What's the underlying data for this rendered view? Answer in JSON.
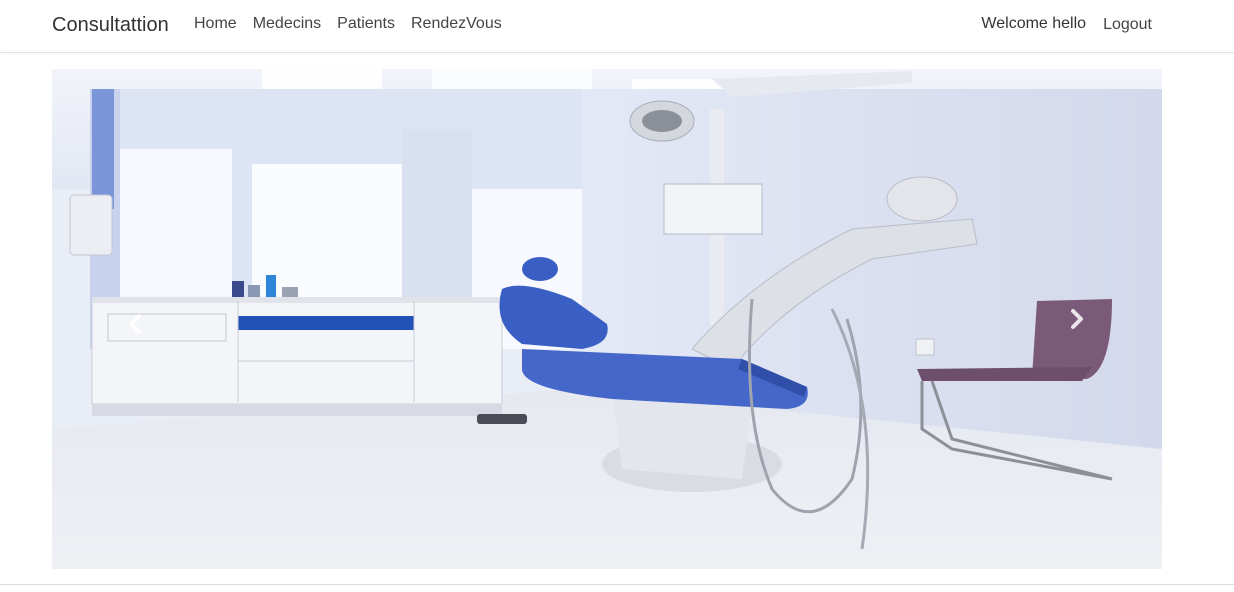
{
  "navbar": {
    "brand": "Consultattion",
    "links": [
      {
        "label": "Home"
      },
      {
        "label": "Medecins"
      },
      {
        "label": "Patients"
      },
      {
        "label": "RendezVous"
      }
    ],
    "welcome_text": "Welcome hello",
    "logout_label": "Logout"
  },
  "carousel": {
    "image_subject": "dental-office",
    "prev_icon": "chevron-left-icon",
    "next_icon": "chevron-right-icon"
  },
  "colors": {
    "brand_text": "#333333",
    "nav_text": "#444444",
    "chair_blue": "#3a5fc4",
    "cabinet_stripe": "#2251b8",
    "visitor_chair": "#7a5a78"
  }
}
